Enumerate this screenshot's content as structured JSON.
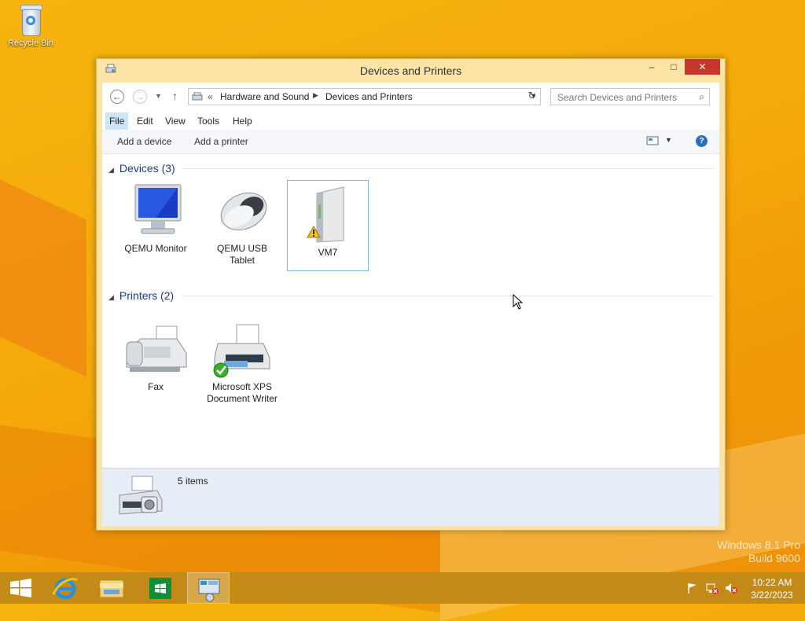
{
  "desktop": {
    "recycle_bin_label": "Recycle Bin",
    "watermark_line1": "Windows 8.1 Pro",
    "watermark_line2": "Build 9600"
  },
  "window": {
    "title": "Devices and Printers",
    "controls": {
      "minimize": "–",
      "maximize": "□",
      "close": "✕"
    }
  },
  "address_bar": {
    "prefix": "«",
    "breadcrumbs": [
      "Hardware and Sound",
      "Devices and Printers"
    ],
    "search_placeholder": "Search Devices and Printers"
  },
  "menu": {
    "items": [
      "File",
      "Edit",
      "View",
      "Tools",
      "Help"
    ],
    "selected": "File"
  },
  "commands": {
    "add_device": "Add a device",
    "add_printer": "Add a printer",
    "help": "?"
  },
  "groups": {
    "devices": {
      "header": "Devices (3)",
      "items": [
        {
          "label_line1": "QEMU Monitor",
          "label_line2": "",
          "icon": "monitor-icon"
        },
        {
          "label_line1": "QEMU USB",
          "label_line2": "Tablet",
          "icon": "mouse-icon"
        },
        {
          "label_line1": "VM7",
          "label_line2": "",
          "icon": "computer-tower-icon",
          "warning": true,
          "selected": true
        }
      ]
    },
    "printers": {
      "header": "Printers (2)",
      "items": [
        {
          "label_line1": "Fax",
          "label_line2": "",
          "icon": "fax-icon"
        },
        {
          "label_line1": "Microsoft XPS",
          "label_line2": "Document Writer",
          "icon": "printer-icon",
          "default": true
        }
      ]
    }
  },
  "status_bar": {
    "item_count": "5 items"
  },
  "taskbar": {
    "apps": [
      "start-icon",
      "internet-explorer-icon",
      "file-explorer-icon",
      "store-icon",
      "devices-and-printers-icon"
    ],
    "active_app": "devices-and-printers-icon",
    "clock_time": "10:22 AM",
    "clock_date": "3/22/2023"
  }
}
